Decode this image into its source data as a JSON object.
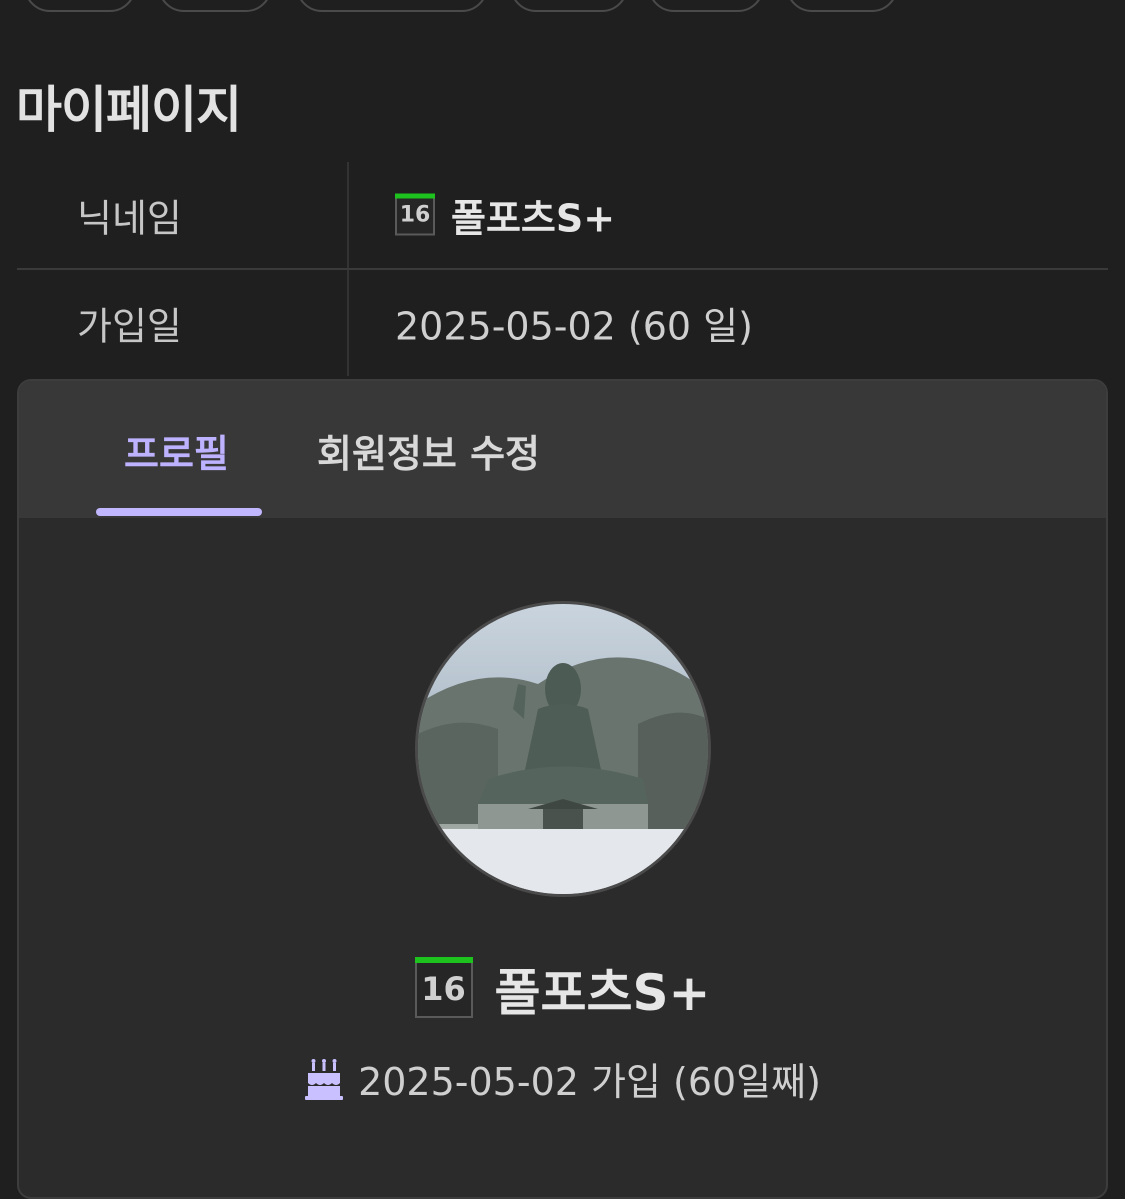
{
  "page": {
    "title": "마이페이지"
  },
  "info": {
    "nickname_label": "닉네임",
    "nickname_level": "16",
    "nickname_value": "폴포츠S+",
    "joined_label": "가입일",
    "joined_value": "2025-05-02 (60 일)"
  },
  "tabs": [
    {
      "label": "프로필",
      "active": true
    },
    {
      "label": "회원정보 수정",
      "active": false
    }
  ],
  "profile": {
    "level": "16",
    "name": "폴포츠S+",
    "joined_text": "2025-05-02 가입 (60일째)",
    "joined_icon": "birthday-cake-icon"
  },
  "colors": {
    "accent": "#bdb2ff",
    "level_bar": "#1ec21e",
    "background": "#1f1f1f"
  }
}
